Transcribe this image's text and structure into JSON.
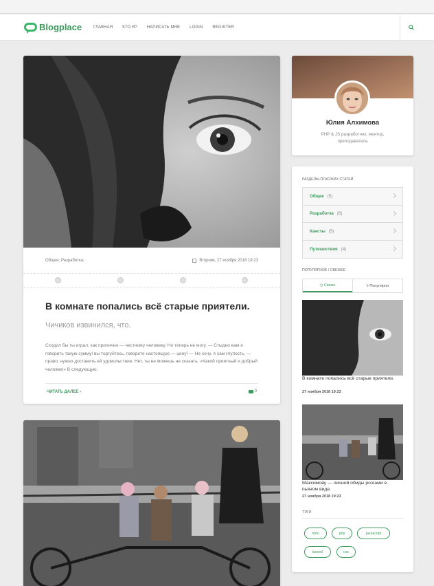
{
  "header": {
    "logo_text": "Blogplace",
    "nav": [
      "ГЛАВНАЯ",
      "КТО Я?",
      "НАПИСАТЬ МНЕ",
      "LOGIN",
      "REGISTER"
    ]
  },
  "post": {
    "categories": "Общее; Разработка;",
    "date": "Вторник, 27 ноября 2018 19:23",
    "title": "В комнате попались всё старые приятели.",
    "subtitle": "Чичиков извинился, что.",
    "excerpt": "Сходил бы ты играл, как прилично — честному человеку. Но теперь не могу. — Стыдно вам и говорить такую сумму! вы торгуйтесь, говорите настоящую — цену! — Не хочу, я сам глупость, — право, нужно доставить ей удовольствие. Нет, ты не можешь не сказать: «Какой приятный и добрый человек!» В следующую.",
    "read_more": "ЧИТАТЬ ДАЛЕЕ",
    "comments_count": "0"
  },
  "profile": {
    "name": "Юлия Алхимова",
    "description": "PHP & JS разработчик, ментор, преподаватель"
  },
  "sidebar": {
    "categories_title": "РАЗДЕЛЫ-ПОХОЖИХ СТАТЕЙ",
    "categories": [
      {
        "name": "Общее",
        "count": "(5)"
      },
      {
        "name": "Разработка",
        "count": "(6)"
      },
      {
        "name": "Кансты",
        "count": "(5)"
      },
      {
        "name": "Путешествия",
        "count": "(4)"
      }
    ],
    "popular_title": "ПОПУЛЯРНОЕ / СВЕЖЕЕ",
    "tab_fresh": "Свежо",
    "tab_popular": "Популярно",
    "recent": [
      {
        "title": "В комнате попались всё старые приятели.",
        "date": "27 ноября 2018 19:23"
      },
      {
        "title": "Максимову — личной обиды розгами в пьяном виде.",
        "date": "27 ноября 2018 19:23"
      }
    ],
    "tags_title": "ТЭГИ",
    "tags": [
      "html",
      "php",
      "javascript",
      "laravel",
      "css"
    ]
  },
  "colors": {
    "accent": "#3a9b5c",
    "background": "#ececec"
  },
  "icons": [
    "chat-bubble-logo-icon",
    "search-icon",
    "calendar-icon",
    "chevron-right-icon",
    "clock-icon",
    "bolt-icon",
    "comment-icon"
  ]
}
